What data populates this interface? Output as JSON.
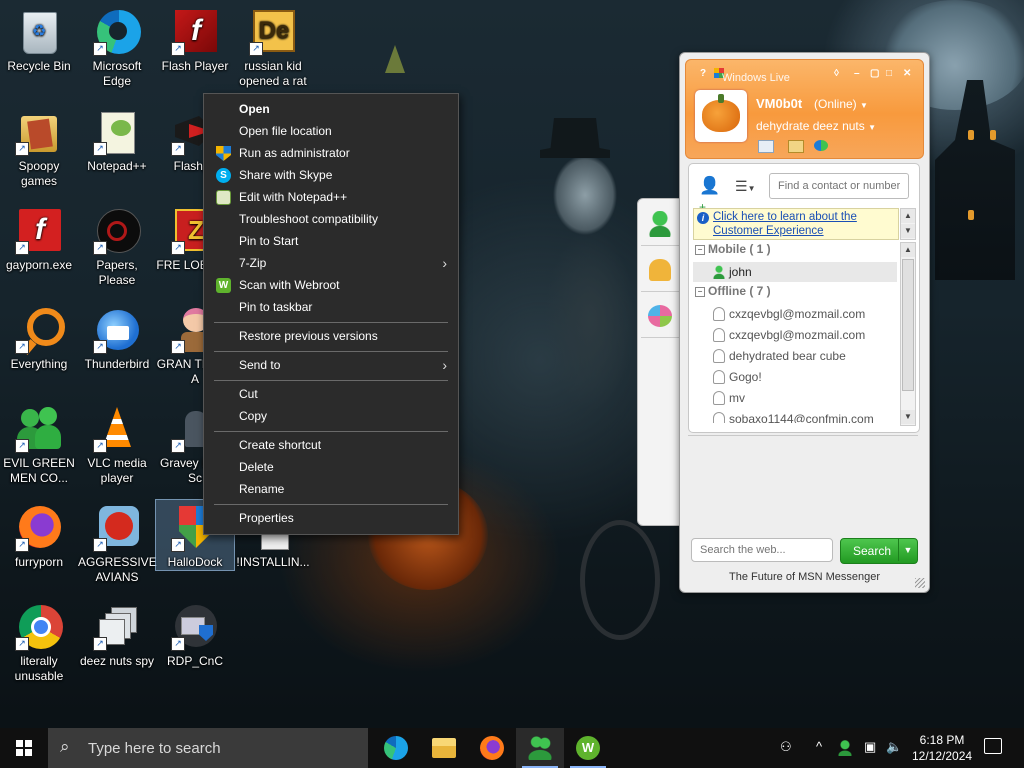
{
  "desktop": {
    "icons": [
      {
        "label": "Recycle Bin"
      },
      {
        "label": "Microsoft Edge"
      },
      {
        "label": "Flash Player"
      },
      {
        "label": "russian kid opened a rat"
      },
      {
        "label": "Spoopy games"
      },
      {
        "label": "Notepad++"
      },
      {
        "label": "Flashpo"
      },
      {
        "label": "gayporn.exe"
      },
      {
        "label": "Papers, Please"
      },
      {
        "label": "FRE LOBOTO"
      },
      {
        "label": "Everything"
      },
      {
        "label": "Thunderbird"
      },
      {
        "label": "GRAN THEFT A"
      },
      {
        "label": "EVIL GREEN MEN CO..."
      },
      {
        "label": "VLC media player"
      },
      {
        "label": "Gravey Party Sc"
      },
      {
        "label": "furryporn"
      },
      {
        "label": "AGGRESSIVE AVIANS"
      },
      {
        "label": "HalloDock"
      },
      {
        "label": "!INSTALLIN..."
      },
      {
        "label": "literally unusable"
      },
      {
        "label": "deez nuts spy"
      },
      {
        "label": "RDP_CnC"
      }
    ]
  },
  "context_menu": {
    "items": [
      {
        "label": "Open",
        "icon": ""
      },
      {
        "label": "Open file location",
        "icon": ""
      },
      {
        "label": "Run as administrator",
        "icon": "uac-shield-icon"
      },
      {
        "label": "Share with Skype",
        "icon": "skype-icon"
      },
      {
        "label": "Edit with Notepad++",
        "icon": "notepad-plus-plus-icon"
      },
      {
        "label": "Troubleshoot compatibility",
        "icon": ""
      },
      {
        "label": "Pin to Start",
        "icon": ""
      },
      {
        "label": "7-Zip",
        "icon": "",
        "submenu": true
      },
      {
        "label": "Scan with Webroot",
        "icon": "webroot-icon"
      },
      {
        "label": "Pin to taskbar",
        "icon": ""
      },
      {
        "label": "Restore previous versions",
        "icon": ""
      },
      {
        "label": "Send to",
        "icon": "",
        "submenu": true
      },
      {
        "label": "Cut",
        "icon": ""
      },
      {
        "label": "Copy",
        "icon": ""
      },
      {
        "label": "Create shortcut",
        "icon": ""
      },
      {
        "label": "Delete",
        "icon": ""
      },
      {
        "label": "Rename",
        "icon": ""
      },
      {
        "label": "Properties",
        "icon": ""
      }
    ],
    "submenu_glyph": "›"
  },
  "messenger": {
    "title": "Windows Live",
    "accent": "#f89a3d",
    "user_name": "VM0b0t",
    "user_status": "(Online)",
    "personal_message": "dehydrate deez nuts",
    "find_placeholder": "Find a contact or number...",
    "ad_text": "Click here to learn about the Customer Experience",
    "groups": [
      {
        "name": "Mobile ( 1 )"
      },
      {
        "name": "Offline ( 7 )"
      }
    ],
    "contacts_mobile": [
      {
        "name": "john"
      }
    ],
    "contacts_offline": [
      {
        "name": "cxzqevbgl@mozmail.com"
      },
      {
        "name": "cxzqevbgl@mozmail.com"
      },
      {
        "name": "dehydrated bear cube"
      },
      {
        "name": "Gogo!"
      },
      {
        "name": "mv"
      },
      {
        "name": "sobaxo1144@confmin.com"
      }
    ],
    "web_search_placeholder": "Search the web...",
    "search_button": "Search",
    "footer": "The Future of MSN Messenger"
  },
  "taskbar": {
    "search_placeholder": "Type here to search",
    "apps": [
      "edge-icon",
      "file-explorer-icon",
      "firefox-icon",
      "msn-messenger-icon",
      "webroot-icon"
    ],
    "time": "6:18 PM",
    "date": "12/12/2024"
  }
}
